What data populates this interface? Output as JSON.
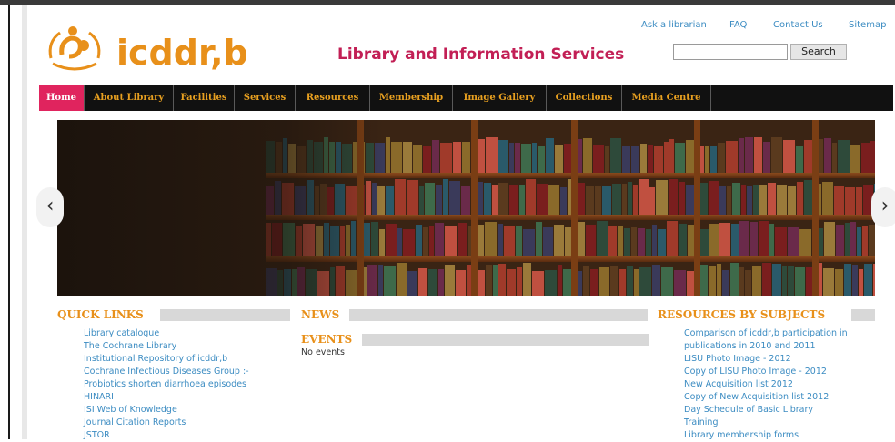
{
  "top_links": [
    "Ask a librarian",
    "FAQ",
    "Contact Us",
    "Sitemap"
  ],
  "logo": {
    "text": "icddr,b"
  },
  "site_title": "Library and Information Services",
  "search": {
    "value": "",
    "button_label": "Search"
  },
  "nav": {
    "items": [
      {
        "label": "Home",
        "active": true
      },
      {
        "label": "About Library",
        "active": false
      },
      {
        "label": "Facilities",
        "active": false
      },
      {
        "label": "Services",
        "active": false
      },
      {
        "label": "Resources",
        "active": false
      },
      {
        "label": "Membership",
        "active": false
      },
      {
        "label": "Image Gallery",
        "active": false
      },
      {
        "label": "Collections",
        "active": false
      },
      {
        "label": "Media Centre",
        "active": false
      }
    ]
  },
  "carousel": {
    "prev_symbol": "‹",
    "next_symbol": "›"
  },
  "quick_links": {
    "heading": "QUICK LINKS",
    "items": [
      "Library catalogue",
      "The Cochrane Library",
      "Institutional Repository of icddr,b",
      "Cochrane Infectious Diseases Group :-",
      "Probiotics shorten diarrhoea episodes",
      "HINARI",
      "ISI Web of Knowledge",
      "Journal Citation Reports",
      "JSTOR"
    ]
  },
  "news": {
    "heading": "NEWS"
  },
  "events": {
    "heading": "EVENTS",
    "empty_text": "No events"
  },
  "resources": {
    "heading": "RESOURCES BY SUBJECTS",
    "items": [
      "Comparison of icddr,b participation in",
      "publications in 2010 and 2011",
      "LISU Photo Image - 2012",
      "Copy of LISU Photo Image - 2012",
      "New Acquisition list 2012",
      "Copy of New Acquisition list 2012",
      "Day Schedule of Basic Library",
      "Training",
      "Library membership forms"
    ]
  },
  "colors": {
    "accent_orange": "#e8901a",
    "title_magenta": "#c21f55",
    "nav_active": "#e0245e",
    "nav_bg": "#111111",
    "link_blue": "#3c8cc2"
  }
}
